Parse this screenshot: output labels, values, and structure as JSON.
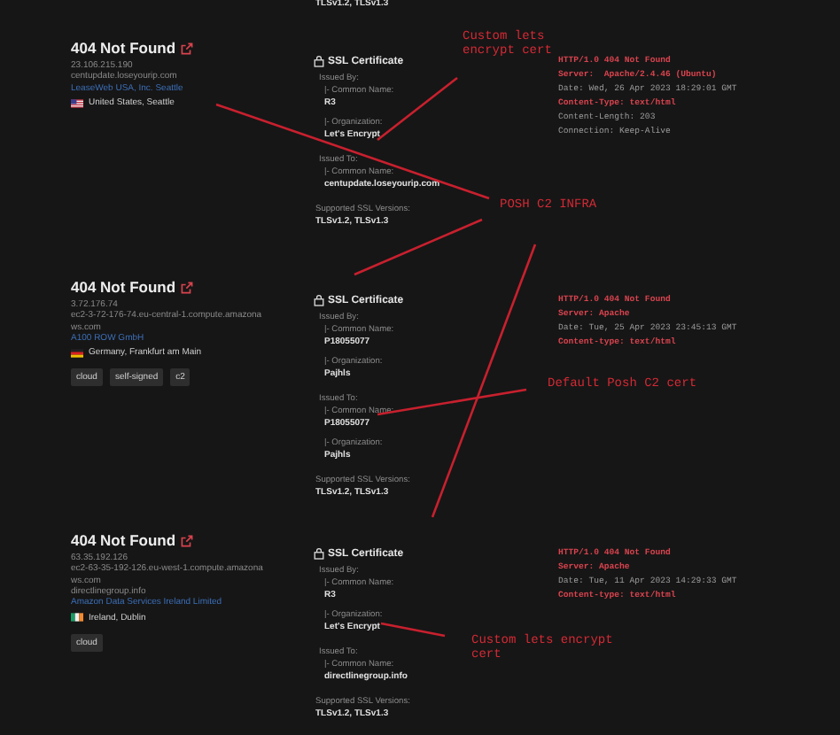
{
  "top_cut_versions": "TLSv1.2, TLSv1.3",
  "results": [
    {
      "title": "404 Not Found",
      "ip": "23.106.215.190",
      "hostnames": [
        "centupdate.loseyourip.com"
      ],
      "org": "LeaseWeb USA, Inc. Seattle",
      "location": {
        "kind": "us",
        "text": "United States, Seattle"
      },
      "ssl": {
        "title": "SSL Certificate",
        "issued_by_label": "Issued By:",
        "issued_by": [
          {
            "label": "|- Common Name:",
            "value": "R3"
          },
          {
            "label": "|- Organization:",
            "value": "Let's Encrypt"
          }
        ],
        "issued_to_label": "Issued To:",
        "issued_to": [
          {
            "label": "|- Common Name:",
            "value": "centupdate.loseyourip.com"
          }
        ],
        "versions_label": "Supported SSL Versions:",
        "versions": "TLSv1.2, TLSv1.3"
      },
      "banner": [
        {
          "text": "HTTP/1.0 404 Not Found",
          "highlight": true
        },
        {
          "text": "Server:  Apache/2.4.46 (Ubuntu)",
          "highlight": true
        },
        {
          "text": "Date: Wed, 26 Apr 2023 18:29:01 GMT",
          "highlight": false
        },
        {
          "text": "Content-Type: text/html",
          "highlight": true
        },
        {
          "text": "Content-Length: 203",
          "highlight": false
        },
        {
          "text": "Connection: Keep-Alive",
          "highlight": false
        }
      ]
    },
    {
      "title": "404 Not Found",
      "ip": "3.72.176.74",
      "hostnames": [
        "ec2-3-72-176-74.eu-central-1.compute.amazonaws.com"
      ],
      "org": "A100 ROW GmbH",
      "location": {
        "kind": "de",
        "text": "Germany, Frankfurt am Main"
      },
      "tags": [
        "cloud",
        "self-signed",
        "c2"
      ],
      "ssl": {
        "title": "SSL Certificate",
        "issued_by_label": "Issued By:",
        "issued_by": [
          {
            "label": "|- Common Name:",
            "value": "P18055077"
          },
          {
            "label": "|- Organization:",
            "value": "Pajhls"
          }
        ],
        "issued_to_label": "Issued To:",
        "issued_to": [
          {
            "label": "|- Common Name:",
            "value": "P18055077"
          },
          {
            "label": "|- Organization:",
            "value": "Pajhls"
          }
        ],
        "versions_label": "Supported SSL Versions:",
        "versions": "TLSv1.2, TLSv1.3"
      },
      "banner": [
        {
          "text": "HTTP/1.0 404 Not Found",
          "highlight": true
        },
        {
          "text": "Server: Apache",
          "highlight": true
        },
        {
          "text": "Date: Tue, 25 Apr 2023 23:45:13 GMT",
          "highlight": false
        },
        {
          "text": "Content-type: text/html",
          "highlight": true
        }
      ]
    },
    {
      "title": "404 Not Found",
      "ip": "63.35.192.126",
      "hostnames": [
        "ec2-63-35-192-126.eu-west-1.compute.amazonaws.com",
        "directlinegroup.info"
      ],
      "org": "Amazon Data Services Ireland Limited",
      "location": {
        "kind": "ie",
        "text": "Ireland, Dublin"
      },
      "tags": [
        "cloud"
      ],
      "ssl": {
        "title": "SSL Certificate",
        "issued_by_label": "Issued By:",
        "issued_by": [
          {
            "label": "|- Common Name:",
            "value": "R3"
          },
          {
            "label": "|- Organization:",
            "value": "Let's Encrypt"
          }
        ],
        "issued_to_label": "Issued To:",
        "issued_to": [
          {
            "label": "|- Common Name:",
            "value": "directlinegroup.info"
          }
        ],
        "versions_label": "Supported SSL Versions:",
        "versions": "TLSv1.2, TLSv1.3"
      },
      "banner": [
        {
          "text": "HTTP/1.0 404 Not Found",
          "highlight": true
        },
        {
          "text": "Server: Apache",
          "highlight": true
        },
        {
          "text": "Date: Tue, 11 Apr 2023 14:29:33 GMT",
          "highlight": false
        },
        {
          "text": "Content-type: text/html",
          "highlight": true
        }
      ]
    }
  ],
  "annotations": [
    {
      "text": "Custom lets\nencrypt cert"
    },
    {
      "text": "POSH C2 INFRA"
    },
    {
      "text": "Default Posh C2 cert"
    },
    {
      "text": "Custom lets encrypt\ncert"
    }
  ]
}
